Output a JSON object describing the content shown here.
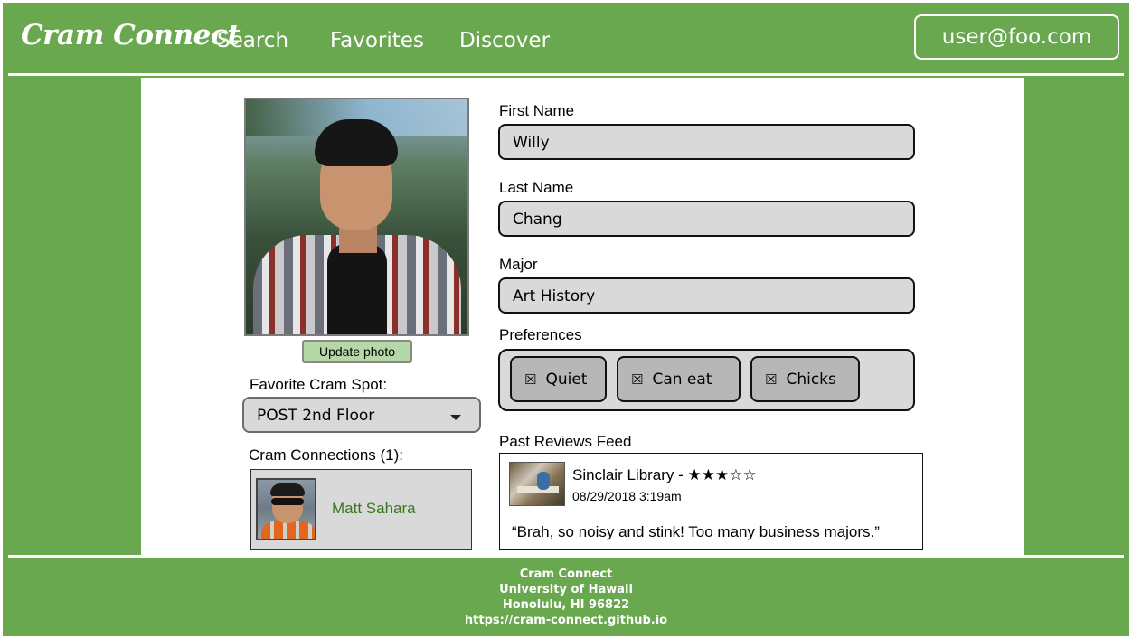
{
  "nav": {
    "brand": "Cram Connect",
    "links": [
      "Search",
      "Favorites",
      "Discover"
    ],
    "user_email": "user@foo.com"
  },
  "profile": {
    "update_photo_label": "Update photo",
    "favorite_spot_label": "Favorite Cram Spot:",
    "favorite_spot_value": "POST 2nd Floor",
    "connections_label": "Cram Connections (1):",
    "connections": [
      {
        "name": "Matt Sahara"
      }
    ]
  },
  "form": {
    "first_name_label": "First Name",
    "first_name_value": "Willy",
    "last_name_label": "Last Name",
    "last_name_value": "Chang",
    "major_label": "Major",
    "major_value": "Art History",
    "preferences_label": "Preferences",
    "preferences": [
      {
        "checkbox": "☒",
        "label": "Quiet"
      },
      {
        "checkbox": "☒",
        "label": "Can eat"
      },
      {
        "checkbox": "☒",
        "label": "Chicks"
      }
    ]
  },
  "reviews": {
    "label": "Past Reviews Feed",
    "items": [
      {
        "title": "Sinclair Library - ★★★☆☆",
        "date": "08/29/2018 3:19am",
        "text": "“Brah, so noisy and stink! Too many business majors.”"
      }
    ]
  },
  "footer": {
    "lines": [
      "Cram Connect",
      "University of Hawaii",
      "Honolulu, HI 96822",
      "https://cram-connect.github.io"
    ]
  },
  "colors": {
    "brand_green": "#6aa84f",
    "field_gray": "#d9d9d9",
    "chip_gray": "#b7b7b7",
    "update_button_green": "#b6d7a8",
    "connection_name_green": "#38761d"
  },
  "icons": {
    "dropdown": "caret-down-icon",
    "checkbox": "checked-box-icon"
  }
}
